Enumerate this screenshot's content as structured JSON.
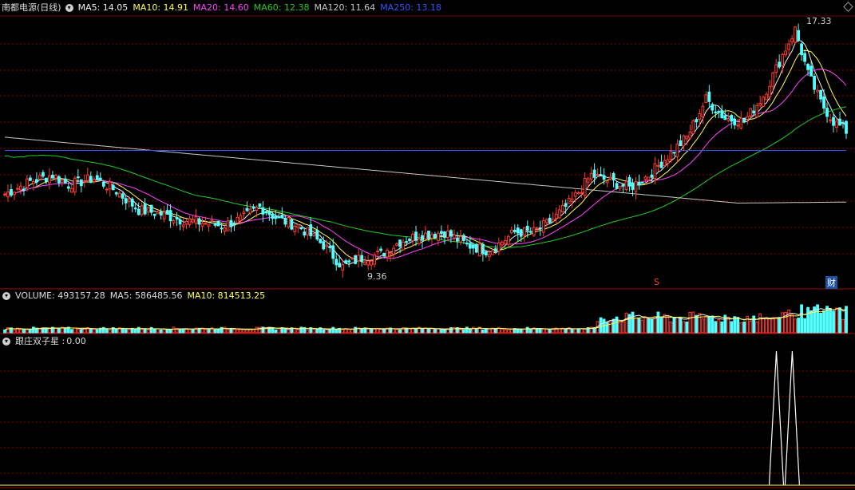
{
  "main_header": {
    "stock_name": "南都电源(日线)",
    "ma5": "MA5: 14.05",
    "ma10": "MA10: 14.91",
    "ma20": "MA20: 14.60",
    "ma60": "MA60: 12.38",
    "ma120": "MA120: 11.64",
    "ma250": "MA250: 13.18"
  },
  "volume_header": {
    "volume": "VOLUME: 493157.28",
    "ma5": "MA5: 586485.56",
    "ma10": "MA10: 814513.25"
  },
  "indicator_header": {
    "name": "跟庄双子星 :",
    "value": "0.00"
  },
  "annotations": {
    "high_label": "17.33",
    "low_label": "9.36",
    "s_marker": "S",
    "cai_marker": "财"
  },
  "colors": {
    "up": "#ff3b30",
    "down": "#54ffff",
    "ma5": "#f0f0f0",
    "ma10": "#ffff55",
    "ma20": "#ff44ff",
    "ma60": "#22cc22",
    "ma120": "#c8c8c8",
    "ma250": "#3355ff",
    "grid": "#8b0000"
  },
  "chart_data": {
    "type": "candlestick",
    "price_high": 17.33,
    "price_low": 9.36,
    "ma250_last": 13.18,
    "signal_days": [
      0,
      0,
      0,
      0,
      0,
      0,
      0,
      0,
      0,
      0,
      0,
      0,
      0,
      0,
      0,
      0,
      0,
      0,
      0,
      0,
      0,
      0,
      0,
      0,
      0,
      0,
      0,
      0,
      0,
      0,
      0,
      0,
      0,
      0,
      0,
      0,
      0,
      0,
      0,
      0,
      0,
      0,
      0,
      0,
      0,
      0,
      0,
      0,
      0,
      0,
      0,
      0,
      0,
      0,
      0,
      0,
      0,
      0,
      0,
      0,
      0,
      0,
      0,
      0,
      0,
      0,
      0,
      0,
      0,
      0,
      0,
      0,
      0,
      0,
      0,
      0,
      0,
      0,
      0,
      0,
      0,
      0,
      0,
      0,
      0,
      0,
      0,
      0,
      0,
      0,
      0,
      0,
      0,
      0,
      0,
      0,
      0,
      0,
      0,
      0,
      0,
      0,
      0,
      0,
      0,
      0,
      0,
      0,
      0,
      0,
      0,
      0,
      0,
      0,
      0,
      0,
      0,
      0,
      0,
      0,
      0,
      0,
      0,
      0,
      0,
      0,
      0,
      0,
      0,
      0,
      0,
      1,
      0,
      0,
      0,
      0,
      0,
      0,
      0,
      0,
      0,
      1,
      0,
      0,
      0,
      0,
      0,
      0,
      0,
      0,
      0,
      0,
      0,
      0,
      0,
      0,
      0,
      0,
      0,
      0,
      0,
      0,
      0,
      0,
      0,
      0,
      0,
      0,
      0,
      0,
      0,
      0,
      0,
      0,
      0,
      0
    ]
  }
}
